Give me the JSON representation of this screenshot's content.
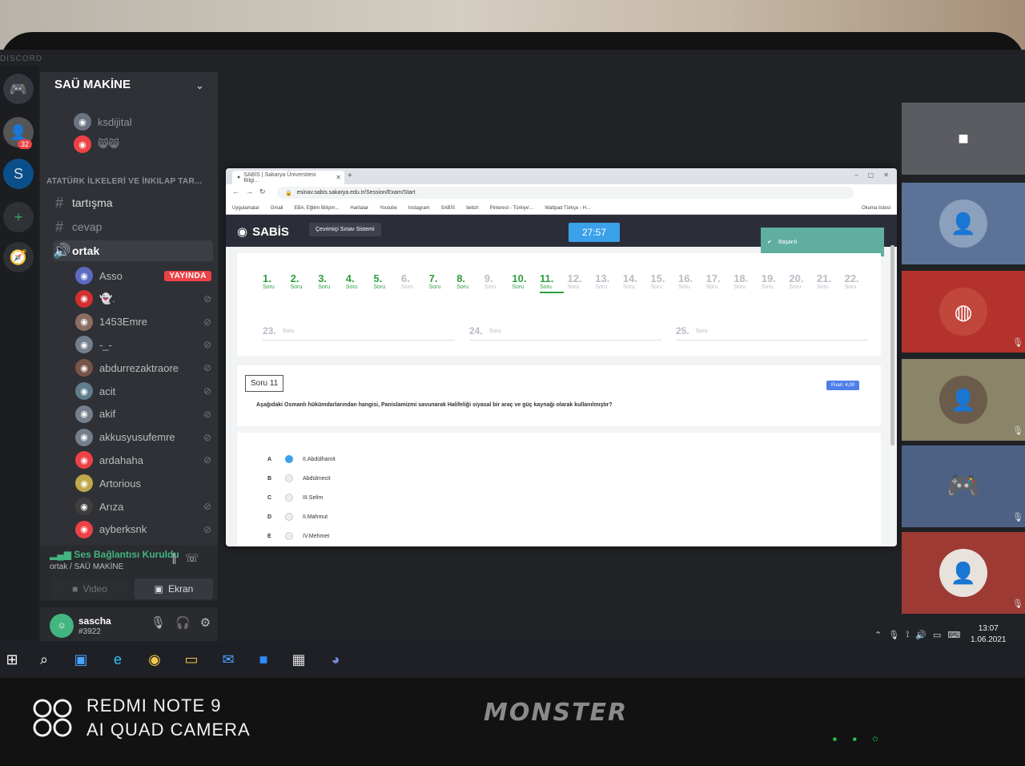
{
  "discord": {
    "brand": "DISCORD",
    "server_badge": "32",
    "server_name": "SAÜ MAKİNE",
    "top_users": [
      {
        "name": "ksdijital",
        "color": "#6b7280"
      },
      {
        "name": "😸😸",
        "color": "#ed4245"
      }
    ],
    "category": "ATATÜRK İLKELERİ VE İNKILAP TAR...",
    "channels": [
      {
        "name": "tartışma",
        "type": "text"
      },
      {
        "name": "cevap",
        "type": "text"
      },
      {
        "name": "ortak",
        "type": "voice"
      }
    ],
    "members": [
      {
        "name": "Asso",
        "live": "YAYINDA",
        "color": "#5c6bc0"
      },
      {
        "name": "👻.",
        "color": "#d32f2f"
      },
      {
        "name": "1453Emre",
        "color": "#8d6e63"
      },
      {
        "name": "-_-",
        "color": "#747f8d"
      },
      {
        "name": "abdurrezaktraore",
        "color": "#795548"
      },
      {
        "name": "acit",
        "color": "#607d8b"
      },
      {
        "name": "akif",
        "color": "#747f8d"
      },
      {
        "name": "akkusyusufemre",
        "color": "#747f8d"
      },
      {
        "name": "ardahaha",
        "color": "#ed4245"
      },
      {
        "name": "Artorious",
        "color": "#c0a84a"
      },
      {
        "name": "Arıza",
        "color": "#3e3e3e"
      },
      {
        "name": "ayberksnk",
        "color": "#ed4245"
      }
    ],
    "voice_status": "Ses Bağlantısı Kuruldu",
    "voice_channel": "ortak / SAÜ MAKİNE",
    "video_label": "Video",
    "screen_label": "Ekran",
    "user": {
      "name": "sascha",
      "tag": "#3922"
    }
  },
  "browser": {
    "tab_title": "SABİS | Sakarya Üniversitesi Bilgi...",
    "url": "esinav.sabis.sakarya.edu.tr/Session/Exam/Start",
    "bookmarks": [
      "Uygulamalar",
      "Gmail",
      "EBA, Eğitim Bilişim...",
      "Haritalar",
      "Youtube",
      "Instagram",
      "SABİS",
      "twitch",
      "Pinterest - Türkiye'...",
      "Wattpad Türkçe - H..."
    ],
    "reading_list": "Okuma listesi"
  },
  "sabis": {
    "logo": "SABİS",
    "nav_tab": "Çevrimiçi Sınav Sistemi",
    "timer": "27:57",
    "toast": "Başarılı",
    "soru_word": "Soru",
    "questions": [
      {
        "num": "1.",
        "state": "done"
      },
      {
        "num": "2.",
        "state": "done"
      },
      {
        "num": "3.",
        "state": "done"
      },
      {
        "num": "4.",
        "state": "done"
      },
      {
        "num": "5.",
        "state": "done"
      },
      {
        "num": "6.",
        "state": "todo"
      },
      {
        "num": "7.",
        "state": "done"
      },
      {
        "num": "8.",
        "state": "done"
      },
      {
        "num": "9.",
        "state": "todo"
      },
      {
        "num": "10.",
        "state": "done"
      },
      {
        "num": "11.",
        "state": "current"
      },
      {
        "num": "12.",
        "state": "todo"
      },
      {
        "num": "13.",
        "state": "todo"
      },
      {
        "num": "14.",
        "state": "todo"
      },
      {
        "num": "15.",
        "state": "todo"
      },
      {
        "num": "16.",
        "state": "todo"
      },
      {
        "num": "17.",
        "state": "todo"
      },
      {
        "num": "18.",
        "state": "todo"
      },
      {
        "num": "19.",
        "state": "todo"
      },
      {
        "num": "20.",
        "state": "todo"
      },
      {
        "num": "21.",
        "state": "todo"
      },
      {
        "num": "22.",
        "state": "todo"
      }
    ],
    "questions_wide": [
      "23.",
      "24.",
      "25."
    ],
    "current_label": "Soru 11",
    "puan": "Puan: 4,00",
    "question_text": "Aşağıdaki Osmanlı hükümdarlarından hangisi, Panislamizmi savunarak Halifeliği siyasal bir araç ve güç kaynağı olarak kullanılmıştır?",
    "answers": [
      {
        "letter": "A",
        "text": "II.Abdülhamit",
        "selected": true
      },
      {
        "letter": "B",
        "text": "Abdülmecit",
        "selected": false
      },
      {
        "letter": "C",
        "text": "III.Selim",
        "selected": false
      },
      {
        "letter": "D",
        "text": "II.Mahmut",
        "selected": false
      },
      {
        "letter": "E",
        "text": "IV.Mehmet",
        "selected": false
      }
    ]
  },
  "system": {
    "time": "13:07",
    "date": "1.06.2021"
  },
  "photo": {
    "laptop_brand": "MONSTER",
    "camera_line1": "REDMI NOTE 9",
    "camera_line2": "AI QUAD CAMERA"
  }
}
